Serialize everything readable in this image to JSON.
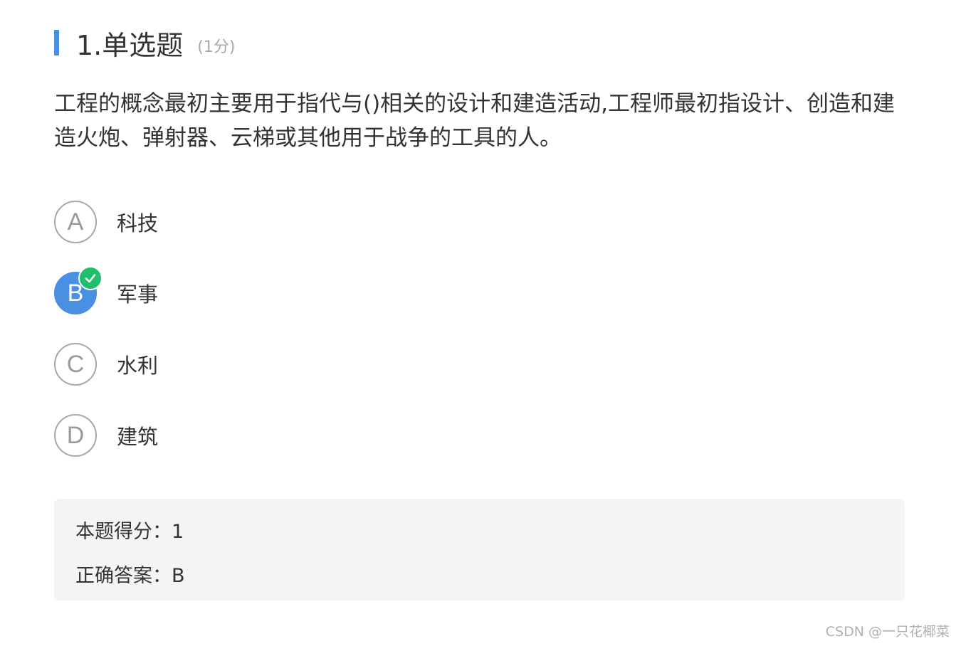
{
  "question": {
    "title": "1.单选题",
    "score": "(1分)",
    "text": "工程的概念最初主要用于指代与()相关的设计和建造活动,工程师最初指设计、创造和建造火炮、弹射器、云梯或其他用于战争的工具的人。"
  },
  "options": [
    {
      "letter": "A",
      "text": "科技",
      "selected": false
    },
    {
      "letter": "B",
      "text": "军事",
      "selected": true
    },
    {
      "letter": "C",
      "text": "水利",
      "selected": false
    },
    {
      "letter": "D",
      "text": "建筑",
      "selected": false
    }
  ],
  "result": {
    "score_label": "本题得分：",
    "score_value": "1",
    "answer_label": "正确答案：",
    "answer_value": "B"
  },
  "watermark": "CSDN @一只花椰菜",
  "colors": {
    "accent": "#4a90e2",
    "check": "#1fbf6c",
    "result_bg": "#f4f4f4"
  },
  "icons": {
    "selected_check": "check-icon"
  }
}
